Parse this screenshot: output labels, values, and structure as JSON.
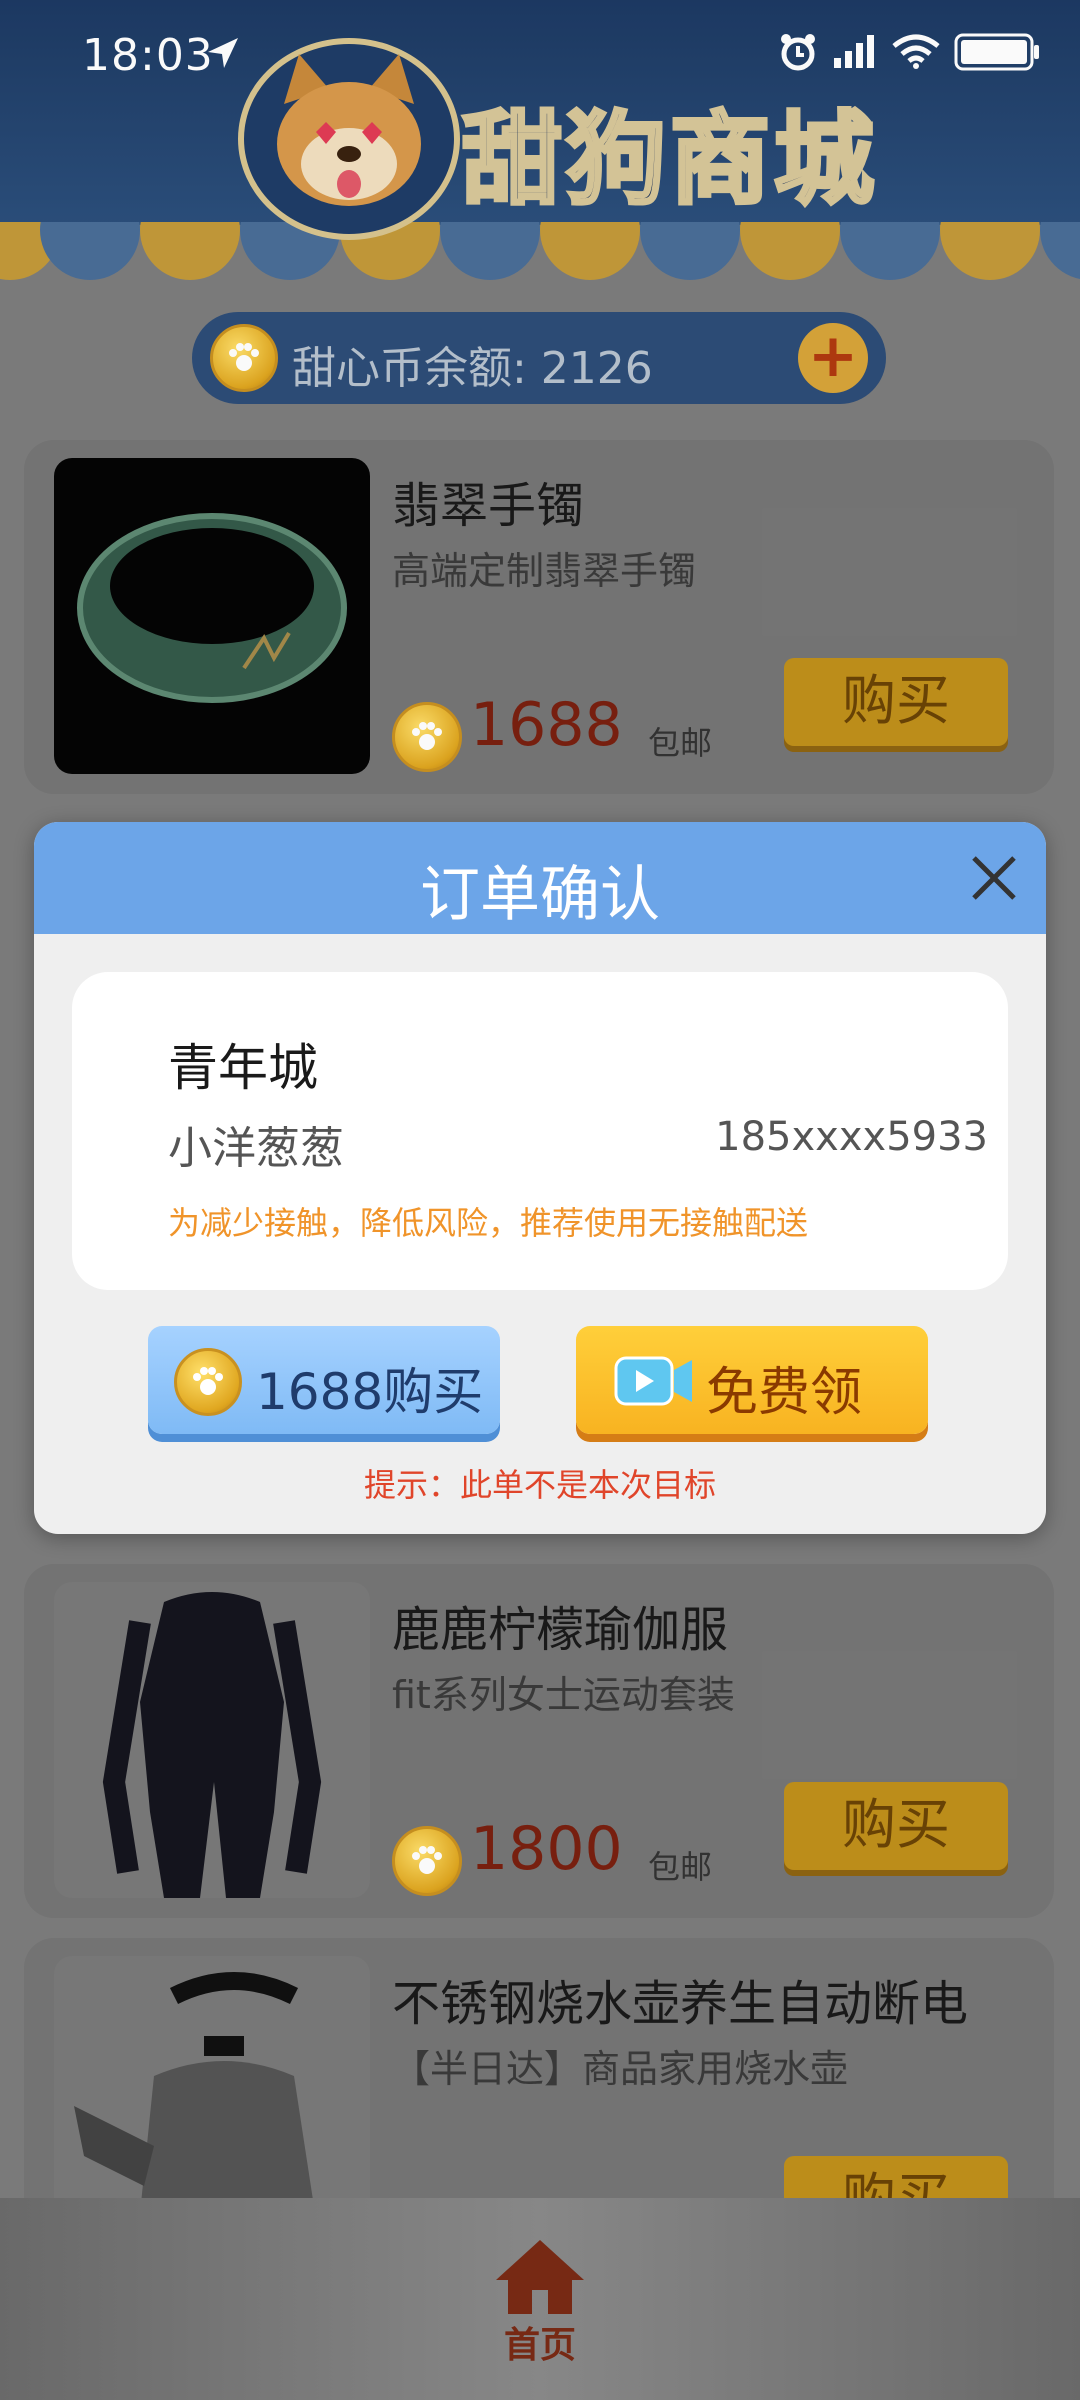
{
  "status_bar": {
    "time": "18:03"
  },
  "header": {
    "store_name": "甜狗商城"
  },
  "balance": {
    "label": "甜心币余额: 2126",
    "add_symbol": "+"
  },
  "products": [
    {
      "title": "翡翠手镯",
      "subtitle": "高端定制翡翠手镯",
      "price": "1688",
      "shipping": "包邮",
      "buy_label": "购买"
    },
    {
      "title": "鹿鹿柠檬瑜伽服",
      "subtitle": "fit系列女士运动套装",
      "price": "1800",
      "shipping": "包邮",
      "buy_label": "购买"
    },
    {
      "title": "不锈钢烧水壶养生自动断电",
      "subtitle": "【半日达】商品家用烧水壶",
      "price": "",
      "shipping": "",
      "buy_label": "购买"
    }
  ],
  "modal": {
    "title": "订单确认",
    "address": {
      "name": "青年城",
      "recipient": "小洋葱葱",
      "phone": "185xxxx5933",
      "note": "为减少接触，降低风险，推荐使用无接触配送"
    },
    "pay_button": "1688购买",
    "free_button": "免费领",
    "tip": "提示：此单不是本次目标"
  },
  "bottom_nav": {
    "home_label": "首页"
  },
  "colors": {
    "accent_blue": "#6ca5e8",
    "accent_orange": "#f8b321",
    "tip_red": "#e0452a",
    "note_orange": "#f0942a"
  },
  "icons": [
    "navigation-icon",
    "alarm-icon",
    "signal-icon",
    "wifi-icon",
    "battery-icon",
    "coin-icon",
    "close-icon",
    "video-icon",
    "home-icon"
  ]
}
